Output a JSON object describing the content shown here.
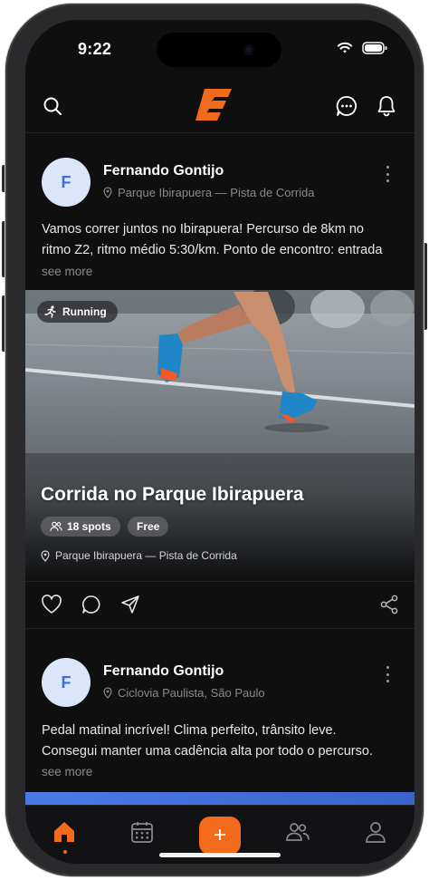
{
  "status_bar": {
    "time": "9:22"
  },
  "colors": {
    "accent": "#f26a1b",
    "background": "#0f0f10",
    "avatar_bg": "#dbe6fb",
    "avatar_text": "#3f6fd6"
  },
  "top_bar": {
    "logo": "brand-logo",
    "icons": [
      "search-icon",
      "chat-icon",
      "bell-icon"
    ]
  },
  "posts": [
    {
      "avatar_initial": "F",
      "author": "Fernando Gontijo",
      "location": "Parque Ibirapuera — Pista de Corrida",
      "text_lines": [
        "Vamos correr juntos no Ibirapuera! Percurso de 8km no",
        "ritmo Z2, ritmo médio 5:30/km. Ponto de encontro: entrada"
      ],
      "see_more": "see more",
      "event": {
        "activity_tag": "Running",
        "title": "Corrida no Parque Ibirapuera",
        "spots": "18 spots",
        "price": "Free",
        "location": "Parque Ibirapuera — Pista de Corrida"
      }
    },
    {
      "avatar_initial": "F",
      "author": "Fernando Gontijo",
      "location": "Ciclovia Paulista, São Paulo",
      "text_lines": [
        "Pedal matinal incrível! Clima perfeito, trânsito leve.",
        "Consegui manter uma cadência alta por todo o percurso."
      ],
      "see_more": "see more"
    }
  ],
  "tab_bar": {
    "active": "home",
    "tabs": [
      "home",
      "calendar",
      "create",
      "groups",
      "profile"
    ],
    "fab_label": "+"
  }
}
